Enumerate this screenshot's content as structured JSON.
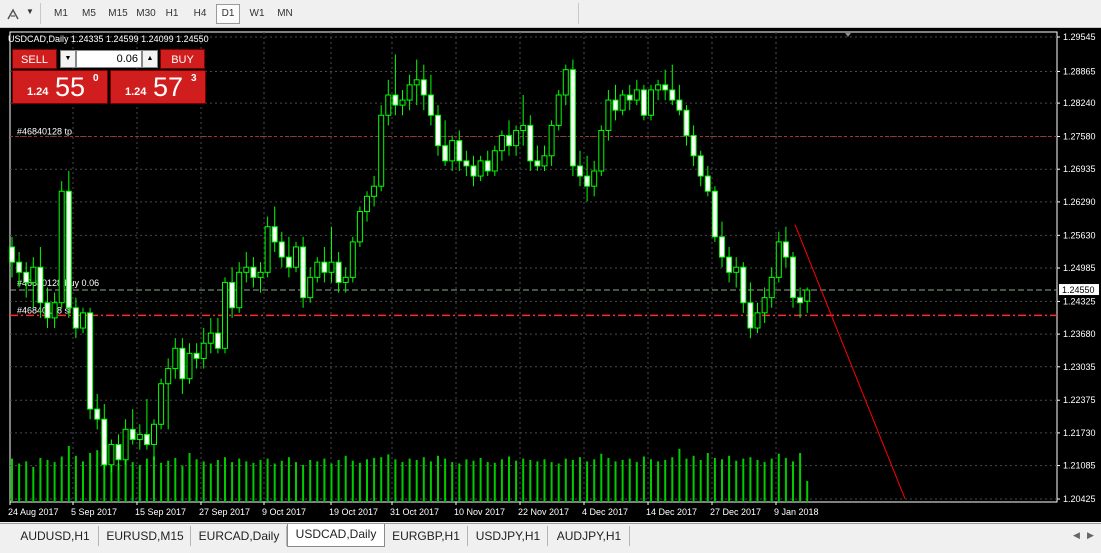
{
  "toolbar": {
    "timeframes": [
      "M1",
      "M5",
      "M15",
      "M30",
      "H1",
      "H4",
      "D1",
      "W1",
      "MN"
    ],
    "active_timeframe": "D1"
  },
  "chart": {
    "header": "USDCAD,Daily  1.24335 1.24599 1.24099 1.24550",
    "order_labels": {
      "tp": "#46840128 tp",
      "buy": "#46840128 buy 0.06",
      "sl": "#46840128 sl"
    },
    "current_price_label": "1.24550",
    "colors": {
      "background": "#000000",
      "grid": "#4a4a4a",
      "candle": "#00ff00",
      "volume": "#00cc00",
      "tp_line": "#b03030",
      "sl_line": "#ff2a2a",
      "trendline": "#ff0000",
      "price_label_bg": "#ffffff"
    }
  },
  "trade_panel": {
    "sell_label": "SELL",
    "buy_label": "BUY",
    "lot_size": "0.06",
    "sell_prefix": "1.24",
    "sell_big": "55",
    "sell_sup": "0",
    "buy_prefix": "1.24",
    "buy_big": "57",
    "buy_sup": "3"
  },
  "symbol_tabs": [
    "AUDUSD,H1",
    "EURUSD,M15",
    "EURCAD,Daily",
    "USDCAD,Daily",
    "EURGBP,H1",
    "USDJPY,H1",
    "AUDJPY,H1"
  ],
  "active_tab": "USDCAD,Daily",
  "chart_data": {
    "type": "candlestick",
    "symbol": "USDCAD",
    "timeframe": "Daily",
    "last_bar": {
      "open": 1.24335,
      "high": 1.24599,
      "low": 1.24099,
      "close": 1.2455
    },
    "y_ticks": [
      1.29545,
      1.28865,
      1.2824,
      1.2758,
      1.26935,
      1.2629,
      1.2563,
      1.24985,
      1.24325,
      1.2368,
      1.23035,
      1.22375,
      1.2173,
      1.21085,
      1.20425
    ],
    "x_ticks": [
      "24 Aug 2017",
      "5 Sep 2017",
      "15 Sep 2017",
      "27 Sep 2017",
      "9 Oct 2017",
      "19 Oct 2017",
      "31 Oct 2017",
      "10 Nov 2017",
      "22 Nov 2017",
      "4 Dec 2017",
      "14 Dec 2017",
      "27 Dec 2017",
      "9 Jan 2018"
    ],
    "ylim": [
      1.20425,
      1.29545
    ],
    "grid": true,
    "order_levels": {
      "tp": 1.2758,
      "entry": 1.2455,
      "sl": 1.2405
    },
    "trendline": {
      "from_date": "29 Dec 2017",
      "from_price": 1.2584,
      "to_date": "19 Jan 2018",
      "to_price": 1.2043
    },
    "candles": [
      {
        "o": 1.254,
        "h": 1.256,
        "l": 1.248,
        "c": 1.251
      },
      {
        "o": 1.251,
        "h": 1.253,
        "l": 1.246,
        "c": 1.249
      },
      {
        "o": 1.249,
        "h": 1.251,
        "l": 1.244,
        "c": 1.247
      },
      {
        "o": 1.247,
        "h": 1.252,
        "l": 1.242,
        "c": 1.25
      },
      {
        "o": 1.25,
        "h": 1.254,
        "l": 1.24,
        "c": 1.243
      },
      {
        "o": 1.243,
        "h": 1.246,
        "l": 1.238,
        "c": 1.24
      },
      {
        "o": 1.24,
        "h": 1.245,
        "l": 1.238,
        "c": 1.243
      },
      {
        "o": 1.243,
        "h": 1.267,
        "l": 1.242,
        "c": 1.265
      },
      {
        "o": 1.265,
        "h": 1.269,
        "l": 1.24,
        "c": 1.242
      },
      {
        "o": 1.242,
        "h": 1.244,
        "l": 1.236,
        "c": 1.238
      },
      {
        "o": 1.238,
        "h": 1.242,
        "l": 1.237,
        "c": 1.241
      },
      {
        "o": 1.241,
        "h": 1.242,
        "l": 1.22,
        "c": 1.222
      },
      {
        "o": 1.222,
        "h": 1.225,
        "l": 1.218,
        "c": 1.22
      },
      {
        "o": 1.22,
        "h": 1.223,
        "l": 1.21,
        "c": 1.211
      },
      {
        "o": 1.211,
        "h": 1.216,
        "l": 1.2095,
        "c": 1.215
      },
      {
        "o": 1.215,
        "h": 1.217,
        "l": 1.21,
        "c": 1.212
      },
      {
        "o": 1.212,
        "h": 1.22,
        "l": 1.211,
        "c": 1.218
      },
      {
        "o": 1.218,
        "h": 1.222,
        "l": 1.215,
        "c": 1.216
      },
      {
        "o": 1.216,
        "h": 1.219,
        "l": 1.214,
        "c": 1.217
      },
      {
        "o": 1.217,
        "h": 1.224,
        "l": 1.214,
        "c": 1.215
      },
      {
        "o": 1.215,
        "h": 1.22,
        "l": 1.212,
        "c": 1.219
      },
      {
        "o": 1.219,
        "h": 1.228,
        "l": 1.218,
        "c": 1.227
      },
      {
        "o": 1.227,
        "h": 1.232,
        "l": 1.218,
        "c": 1.23
      },
      {
        "o": 1.23,
        "h": 1.236,
        "l": 1.228,
        "c": 1.234
      },
      {
        "o": 1.234,
        "h": 1.236,
        "l": 1.225,
        "c": 1.228
      },
      {
        "o": 1.228,
        "h": 1.235,
        "l": 1.227,
        "c": 1.233
      },
      {
        "o": 1.233,
        "h": 1.235,
        "l": 1.23,
        "c": 1.232
      },
      {
        "o": 1.232,
        "h": 1.238,
        "l": 1.23,
        "c": 1.235
      },
      {
        "o": 1.235,
        "h": 1.24,
        "l": 1.233,
        "c": 1.237
      },
      {
        "o": 1.237,
        "h": 1.24,
        "l": 1.233,
        "c": 1.234
      },
      {
        "o": 1.234,
        "h": 1.248,
        "l": 1.233,
        "c": 1.247
      },
      {
        "o": 1.247,
        "h": 1.25,
        "l": 1.24,
        "c": 1.242
      },
      {
        "o": 1.242,
        "h": 1.251,
        "l": 1.241,
        "c": 1.249
      },
      {
        "o": 1.249,
        "h": 1.253,
        "l": 1.247,
        "c": 1.25
      },
      {
        "o": 1.25,
        "h": 1.252,
        "l": 1.246,
        "c": 1.248
      },
      {
        "o": 1.248,
        "h": 1.251,
        "l": 1.245,
        "c": 1.249
      },
      {
        "o": 1.249,
        "h": 1.26,
        "l": 1.248,
        "c": 1.258
      },
      {
        "o": 1.258,
        "h": 1.262,
        "l": 1.253,
        "c": 1.255
      },
      {
        "o": 1.255,
        "h": 1.257,
        "l": 1.25,
        "c": 1.252
      },
      {
        "o": 1.252,
        "h": 1.256,
        "l": 1.248,
        "c": 1.25
      },
      {
        "o": 1.25,
        "h": 1.255,
        "l": 1.249,
        "c": 1.254
      },
      {
        "o": 1.254,
        "h": 1.256,
        "l": 1.242,
        "c": 1.244
      },
      {
        "o": 1.244,
        "h": 1.25,
        "l": 1.243,
        "c": 1.248
      },
      {
        "o": 1.248,
        "h": 1.252,
        "l": 1.247,
        "c": 1.251
      },
      {
        "o": 1.251,
        "h": 1.254,
        "l": 1.247,
        "c": 1.249
      },
      {
        "o": 1.249,
        "h": 1.258,
        "l": 1.247,
        "c": 1.251
      },
      {
        "o": 1.251,
        "h": 1.253,
        "l": 1.245,
        "c": 1.247
      },
      {
        "o": 1.247,
        "h": 1.25,
        "l": 1.245,
        "c": 1.248
      },
      {
        "o": 1.248,
        "h": 1.256,
        "l": 1.247,
        "c": 1.255
      },
      {
        "o": 1.255,
        "h": 1.262,
        "l": 1.254,
        "c": 1.261
      },
      {
        "o": 1.261,
        "h": 1.265,
        "l": 1.259,
        "c": 1.264
      },
      {
        "o": 1.264,
        "h": 1.268,
        "l": 1.262,
        "c": 1.266
      },
      {
        "o": 1.266,
        "h": 1.282,
        "l": 1.265,
        "c": 1.28
      },
      {
        "o": 1.28,
        "h": 1.287,
        "l": 1.278,
        "c": 1.284
      },
      {
        "o": 1.284,
        "h": 1.292,
        "l": 1.28,
        "c": 1.282
      },
      {
        "o": 1.282,
        "h": 1.285,
        "l": 1.28,
        "c": 1.283
      },
      {
        "o": 1.283,
        "h": 1.288,
        "l": 1.281,
        "c": 1.286
      },
      {
        "o": 1.286,
        "h": 1.291,
        "l": 1.282,
        "c": 1.287
      },
      {
        "o": 1.287,
        "h": 1.29,
        "l": 1.281,
        "c": 1.284
      },
      {
        "o": 1.284,
        "h": 1.288,
        "l": 1.278,
        "c": 1.28
      },
      {
        "o": 1.28,
        "h": 1.282,
        "l": 1.272,
        "c": 1.274
      },
      {
        "o": 1.274,
        "h": 1.279,
        "l": 1.27,
        "c": 1.271
      },
      {
        "o": 1.271,
        "h": 1.276,
        "l": 1.269,
        "c": 1.275
      },
      {
        "o": 1.275,
        "h": 1.277,
        "l": 1.269,
        "c": 1.271
      },
      {
        "o": 1.271,
        "h": 1.273,
        "l": 1.268,
        "c": 1.27
      },
      {
        "o": 1.27,
        "h": 1.272,
        "l": 1.266,
        "c": 1.268
      },
      {
        "o": 1.268,
        "h": 1.272,
        "l": 1.267,
        "c": 1.271
      },
      {
        "o": 1.271,
        "h": 1.273,
        "l": 1.268,
        "c": 1.269
      },
      {
        "o": 1.269,
        "h": 1.274,
        "l": 1.268,
        "c": 1.273
      },
      {
        "o": 1.273,
        "h": 1.277,
        "l": 1.271,
        "c": 1.276
      },
      {
        "o": 1.276,
        "h": 1.279,
        "l": 1.272,
        "c": 1.274
      },
      {
        "o": 1.274,
        "h": 1.278,
        "l": 1.272,
        "c": 1.277
      },
      {
        "o": 1.277,
        "h": 1.284,
        "l": 1.274,
        "c": 1.278
      },
      {
        "o": 1.278,
        "h": 1.28,
        "l": 1.269,
        "c": 1.271
      },
      {
        "o": 1.271,
        "h": 1.274,
        "l": 1.269,
        "c": 1.27
      },
      {
        "o": 1.27,
        "h": 1.274,
        "l": 1.269,
        "c": 1.272
      },
      {
        "o": 1.272,
        "h": 1.279,
        "l": 1.27,
        "c": 1.278
      },
      {
        "o": 1.278,
        "h": 1.285,
        "l": 1.277,
        "c": 1.284
      },
      {
        "o": 1.284,
        "h": 1.29,
        "l": 1.282,
        "c": 1.289
      },
      {
        "o": 1.289,
        "h": 1.291,
        "l": 1.268,
        "c": 1.27
      },
      {
        "o": 1.27,
        "h": 1.273,
        "l": 1.266,
        "c": 1.268
      },
      {
        "o": 1.268,
        "h": 1.272,
        "l": 1.263,
        "c": 1.266
      },
      {
        "o": 1.266,
        "h": 1.271,
        "l": 1.264,
        "c": 1.269
      },
      {
        "o": 1.269,
        "h": 1.278,
        "l": 1.268,
        "c": 1.277
      },
      {
        "o": 1.277,
        "h": 1.285,
        "l": 1.275,
        "c": 1.283
      },
      {
        "o": 1.283,
        "h": 1.286,
        "l": 1.279,
        "c": 1.281
      },
      {
        "o": 1.281,
        "h": 1.285,
        "l": 1.28,
        "c": 1.284
      },
      {
        "o": 1.284,
        "h": 1.286,
        "l": 1.281,
        "c": 1.283
      },
      {
        "o": 1.283,
        "h": 1.287,
        "l": 1.282,
        "c": 1.285
      },
      {
        "o": 1.285,
        "h": 1.286,
        "l": 1.279,
        "c": 1.28
      },
      {
        "o": 1.28,
        "h": 1.286,
        "l": 1.279,
        "c": 1.285
      },
      {
        "o": 1.285,
        "h": 1.287,
        "l": 1.283,
        "c": 1.286
      },
      {
        "o": 1.286,
        "h": 1.289,
        "l": 1.283,
        "c": 1.285
      },
      {
        "o": 1.285,
        "h": 1.29,
        "l": 1.282,
        "c": 1.283
      },
      {
        "o": 1.283,
        "h": 1.286,
        "l": 1.28,
        "c": 1.281
      },
      {
        "o": 1.281,
        "h": 1.282,
        "l": 1.274,
        "c": 1.276
      },
      {
        "o": 1.276,
        "h": 1.278,
        "l": 1.27,
        "c": 1.272
      },
      {
        "o": 1.272,
        "h": 1.273,
        "l": 1.266,
        "c": 1.268
      },
      {
        "o": 1.268,
        "h": 1.27,
        "l": 1.264,
        "c": 1.265
      },
      {
        "o": 1.265,
        "h": 1.266,
        "l": 1.255,
        "c": 1.256
      },
      {
        "o": 1.256,
        "h": 1.259,
        "l": 1.25,
        "c": 1.252
      },
      {
        "o": 1.252,
        "h": 1.254,
        "l": 1.247,
        "c": 1.249
      },
      {
        "o": 1.249,
        "h": 1.252,
        "l": 1.246,
        "c": 1.25
      },
      {
        "o": 1.25,
        "h": 1.251,
        "l": 1.241,
        "c": 1.243
      },
      {
        "o": 1.243,
        "h": 1.247,
        "l": 1.236,
        "c": 1.238
      },
      {
        "o": 1.238,
        "h": 1.243,
        "l": 1.237,
        "c": 1.241
      },
      {
        "o": 1.241,
        "h": 1.246,
        "l": 1.239,
        "c": 1.244
      },
      {
        "o": 1.244,
        "h": 1.25,
        "l": 1.242,
        "c": 1.248
      },
      {
        "o": 1.248,
        "h": 1.257,
        "l": 1.247,
        "c": 1.255
      },
      {
        "o": 1.255,
        "h": 1.258,
        "l": 1.25,
        "c": 1.252
      },
      {
        "o": 1.252,
        "h": 1.253,
        "l": 1.242,
        "c": 1.244
      },
      {
        "o": 1.244,
        "h": 1.246,
        "l": 1.24,
        "c": 1.243
      },
      {
        "o": 1.2433,
        "h": 1.246,
        "l": 1.241,
        "c": 1.2455
      }
    ],
    "volumes": [
      0.62,
      0.55,
      0.58,
      0.5,
      0.63,
      0.6,
      0.57,
      0.65,
      0.8,
      0.66,
      0.58,
      0.7,
      0.74,
      0.62,
      0.66,
      0.55,
      0.6,
      0.57,
      0.53,
      0.62,
      0.65,
      0.56,
      0.59,
      0.63,
      0.52,
      0.7,
      0.61,
      0.58,
      0.55,
      0.6,
      0.64,
      0.57,
      0.62,
      0.58,
      0.56,
      0.6,
      0.62,
      0.55,
      0.59,
      0.64,
      0.57,
      0.53,
      0.6,
      0.58,
      0.62,
      0.55,
      0.6,
      0.66,
      0.59,
      0.56,
      0.61,
      0.63,
      0.64,
      0.68,
      0.61,
      0.57,
      0.62,
      0.6,
      0.64,
      0.58,
      0.66,
      0.62,
      0.57,
      0.55,
      0.61,
      0.59,
      0.63,
      0.57,
      0.56,
      0.61,
      0.65,
      0.59,
      0.62,
      0.6,
      0.58,
      0.61,
      0.57,
      0.55,
      0.62,
      0.6,
      0.64,
      0.58,
      0.61,
      0.69,
      0.63,
      0.58,
      0.6,
      0.62,
      0.57,
      0.65,
      0.61,
      0.58,
      0.6,
      0.64,
      0.76,
      0.62,
      0.66,
      0.6,
      0.7,
      0.63,
      0.61,
      0.66,
      0.59,
      0.62,
      0.64,
      0.6,
      0.57,
      0.62,
      0.69,
      0.63,
      0.58,
      0.7,
      0.3
    ]
  }
}
